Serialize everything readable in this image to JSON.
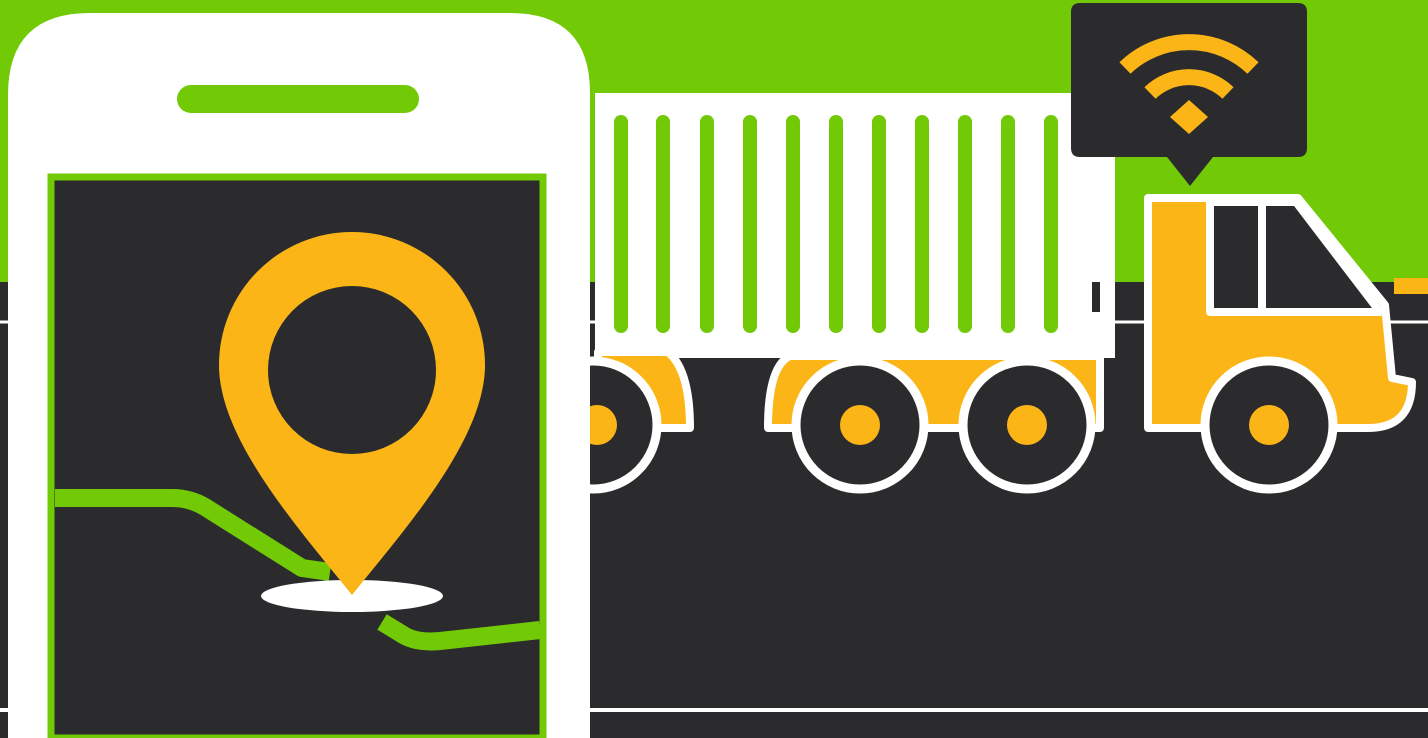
{
  "colors": {
    "green": "#72c905",
    "dark": "#2b2b2e",
    "yellow": "#fbb516",
    "white": "#ffffff"
  },
  "icons": [
    "smartphone-icon",
    "map-pin-icon",
    "route-line",
    "truck-icon",
    "wifi-icon"
  ],
  "illustration": {
    "phone": {
      "screen": "map",
      "pin": "location-pin"
    },
    "truck": {
      "trailer": "container",
      "signal": "wifi"
    }
  }
}
